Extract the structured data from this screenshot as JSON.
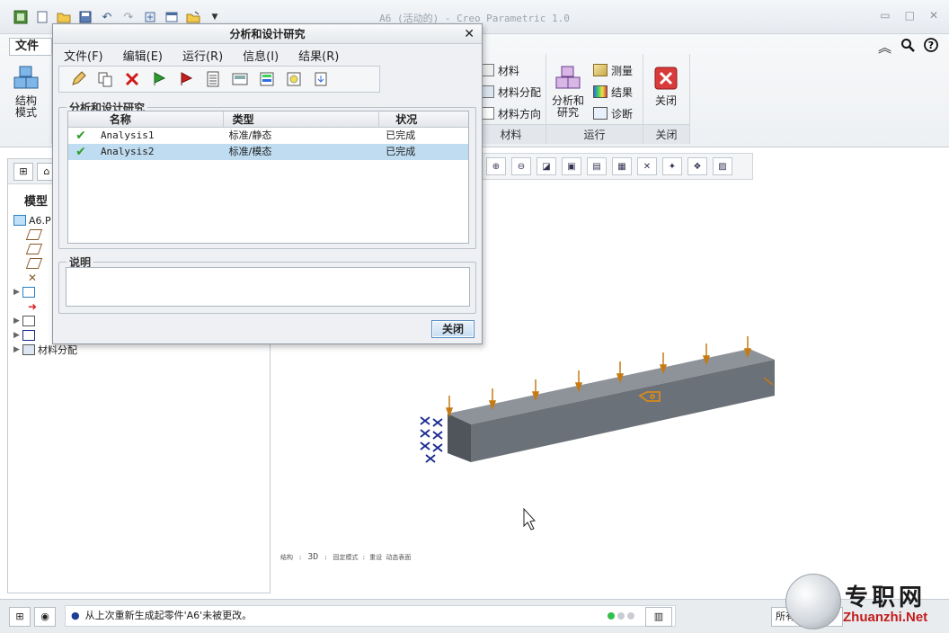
{
  "window": {
    "title": "A6 (活动的) - Creo Parametric 1.0"
  },
  "ribbon": {
    "file_tab": "文件",
    "structure_mode": "结构\n模式",
    "material": {
      "items": [
        "材料",
        "材料分配",
        "材料方向"
      ],
      "label": "材料"
    },
    "run": {
      "analysis_label": "分析和\n研究",
      "items": [
        "测量",
        "结果",
        "诊断"
      ],
      "label": "运行"
    },
    "close": {
      "button_label": "关闭",
      "label": "关闭"
    }
  },
  "model_tree": {
    "header": "模型",
    "root": "A6.P",
    "last_item": "材料分配"
  },
  "dialog": {
    "title": "分析和设计研究",
    "menu": [
      "文件(F)",
      "编辑(E)",
      "运行(R)",
      "信息(I)",
      "结果(R)"
    ],
    "studies_group": "分析和设计研究",
    "columns": {
      "name": "名称",
      "type": "类型",
      "status": "状况"
    },
    "rows": [
      {
        "name": "Analysis1",
        "type": "标准/静态",
        "status": "已完成"
      },
      {
        "name": "Analysis2",
        "type": "标准/模态",
        "status": "已完成"
      }
    ],
    "selected_row": 2,
    "description_group": "说明",
    "description": "",
    "close_button": "关闭"
  },
  "viewport": {
    "info_left": "结构",
    "info_mid": "3D",
    "info_right": "固定模式  :  重设  动态表面"
  },
  "status": {
    "message": "从上次重新生成起零件'A6'未被更改。",
    "filter": "所有"
  },
  "watermark": {
    "cn": "专职网",
    "en": "Zhuanzhi.Net"
  },
  "colors": {
    "accent": "#5a8ec2",
    "selection": "#bfdcf0",
    "check_green": "#2f9e2a",
    "load_orange": "#c67a12",
    "beam_gray": "#6b7178",
    "constraint_blue": "#1a2b8f",
    "close_red": "#d93a3a"
  }
}
